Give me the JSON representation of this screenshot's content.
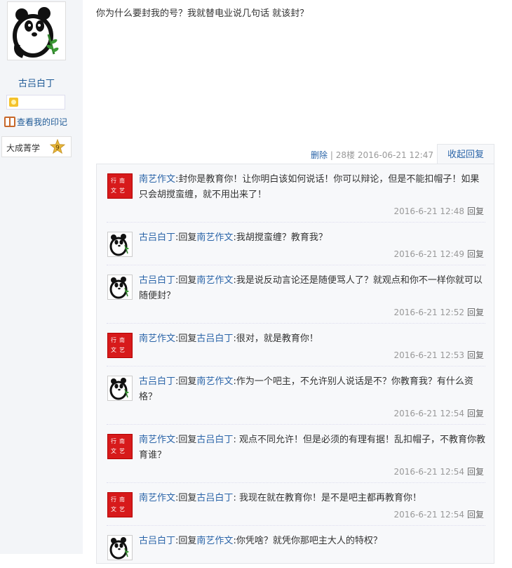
{
  "sidebar": {
    "username": "古吕白丁",
    "imprint_link": "查看我的印记",
    "level_name": "大成菁学",
    "level_number": "9"
  },
  "post": {
    "content": "你为什么要封我的号？我就替电业说几句话 就该封？",
    "delete_label": "删除",
    "separator": "|",
    "floor": "28楼",
    "timestamp": "2016-06-21 12:47",
    "collapse_label": "收起回复"
  },
  "replies": [
    {
      "user": "南艺作文",
      "colon": ":",
      "reply_word": "",
      "reply_to": "",
      "text": "封你是教育你！让你明白该如何说话！你可以辩论，但是不能扣帽子！如果只会胡搅蛮缠，就不用出来了！",
      "time": "2016-6-21 12:48",
      "reply_label": "回复"
    },
    {
      "user": "古吕白丁",
      "colon": ":",
      "reply_word": "回复",
      "reply_to": "南艺作文",
      "text": ":我胡搅蛮缠？教育我？",
      "time": "2016-6-21 12:49",
      "reply_label": "回复"
    },
    {
      "user": "古吕白丁",
      "colon": ":",
      "reply_word": "回复",
      "reply_to": "南艺作文",
      "text": ":我是说反动言论还是随便骂人了？就观点和你不一样你就可以随便封？",
      "time": "2016-6-21 12:52",
      "reply_label": "回复"
    },
    {
      "user": "南艺作文",
      "colon": ":",
      "reply_word": "回复",
      "reply_to": "古吕白丁",
      "text": ":很对，就是教育你！",
      "time": "2016-6-21 12:53",
      "reply_label": "回复"
    },
    {
      "user": "古吕白丁",
      "colon": ":",
      "reply_word": "回复",
      "reply_to": "南艺作文",
      "text": ":作为一个吧主，不允许别人说话是不？你教育我？有什么资格？",
      "time": "2016-6-21 12:54",
      "reply_label": "回复"
    },
    {
      "user": "南艺作文",
      "colon": ":",
      "reply_word": "回复",
      "reply_to": "古吕白丁",
      "text": ": 观点不同允许！但是必须的有理有据！乱扣帽子，不教育你教育谁？",
      "time": "2016-6-21 12:54",
      "reply_label": "回复"
    },
    {
      "user": "南艺作文",
      "colon": ":",
      "reply_word": "回复",
      "reply_to": "古吕白丁",
      "text": ": 我现在就在教育你！是不是吧主都再教育你！",
      "time": "2016-6-21 12:54",
      "reply_label": "回复"
    },
    {
      "user": "古吕白丁",
      "colon": ":",
      "reply_word": "回复",
      "reply_to": "南艺作文",
      "text": ":你凭啥？就凭你那吧主大人的特权？",
      "time": "",
      "reply_label": ""
    }
  ],
  "avatar_seal": [
    "行",
    "南",
    "文",
    "艺"
  ],
  "colors": {
    "link": "#2a64a8",
    "seal_red": "#d71a1b",
    "meta_gray": "#999999"
  }
}
